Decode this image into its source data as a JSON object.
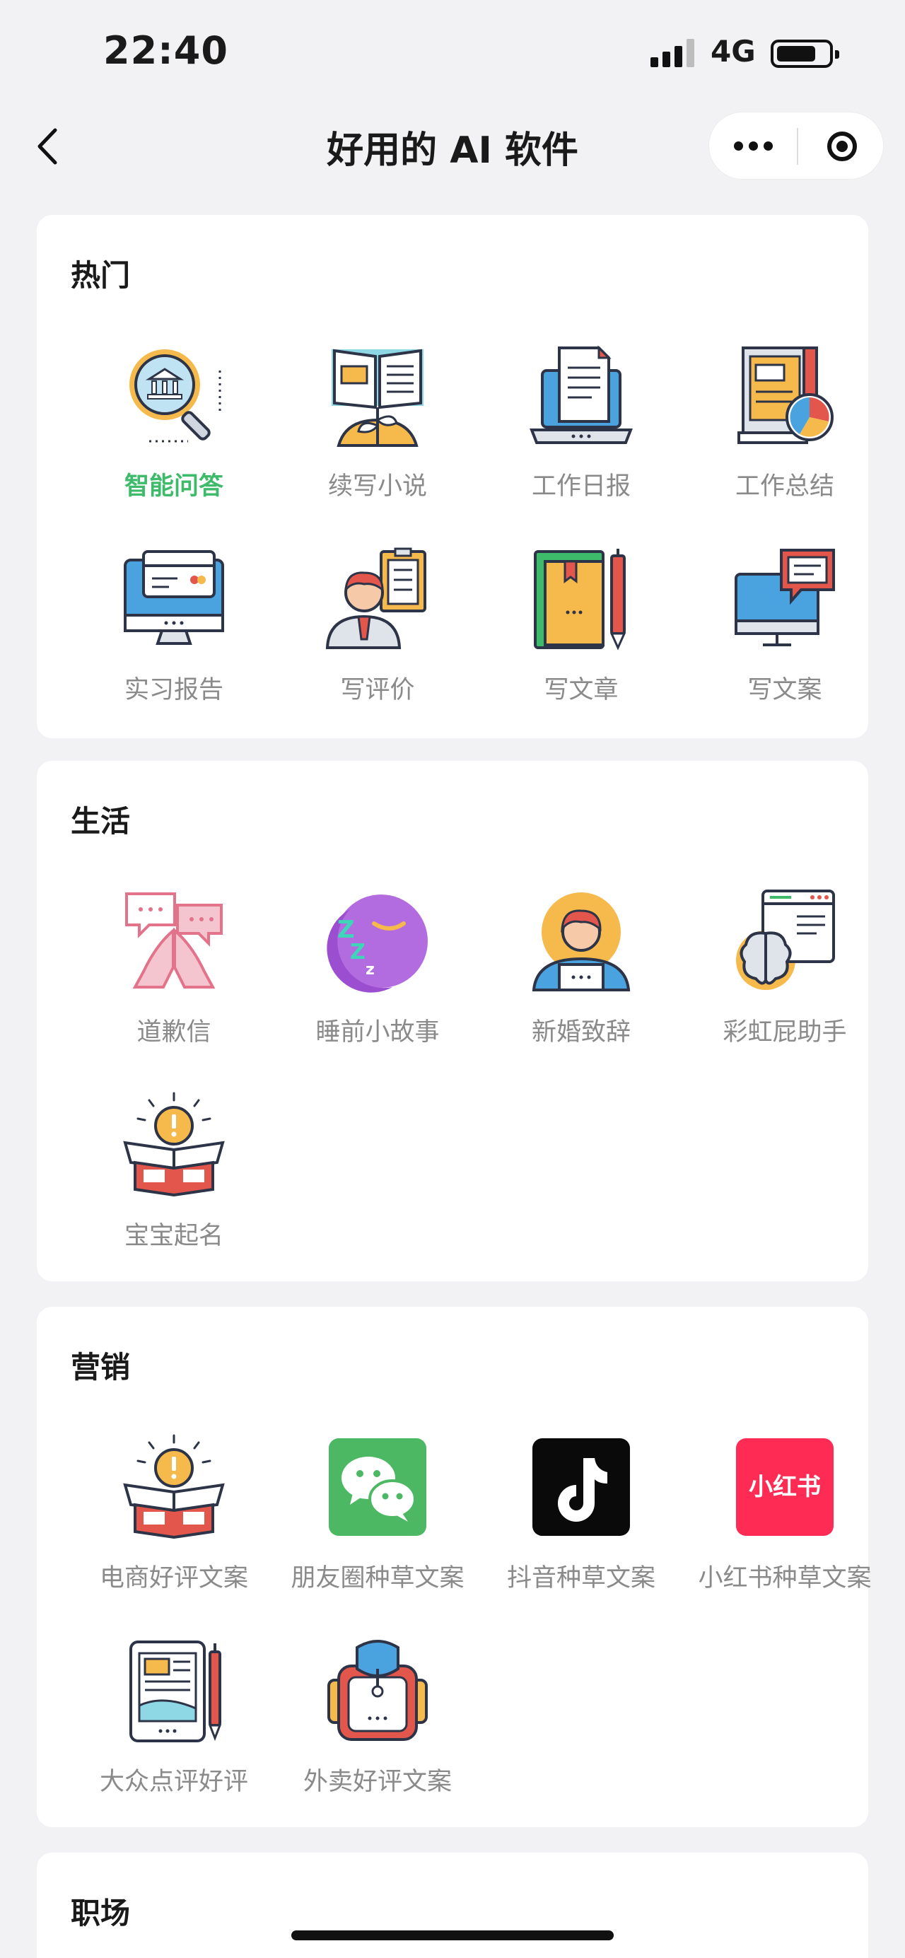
{
  "status_bar": {
    "time": "22:40",
    "network": "4G"
  },
  "nav": {
    "title": "好用的 AI 软件"
  },
  "sections": {
    "hot": {
      "title": "热门",
      "items": [
        {
          "label": "智能问答",
          "icon": "magnifier-bank-icon",
          "active": true
        },
        {
          "label": "续写小说",
          "icon": "open-book-icon"
        },
        {
          "label": "工作日报",
          "icon": "laptop-document-icon"
        },
        {
          "label": "工作总结",
          "icon": "report-chart-icon"
        },
        {
          "label": "实习报告",
          "icon": "monitor-card-icon"
        },
        {
          "label": "写评价",
          "icon": "person-clipboard-icon"
        },
        {
          "label": "写文章",
          "icon": "book-pen-icon"
        },
        {
          "label": "写文案",
          "icon": "monitor-chat-icon"
        }
      ]
    },
    "life": {
      "title": "生活",
      "items": [
        {
          "label": "道歉信",
          "icon": "pray-hands-icon"
        },
        {
          "label": "睡前小故事",
          "icon": "moon-sleep-icon"
        },
        {
          "label": "新婚致辞",
          "icon": "person-laptop-icon"
        },
        {
          "label": "彩虹屁助手",
          "icon": "brain-browser-icon"
        },
        {
          "label": "宝宝起名",
          "icon": "idea-box-icon"
        }
      ]
    },
    "marketing": {
      "title": "营销",
      "items": [
        {
          "label": "电商好评文案",
          "icon": "idea-box-icon"
        },
        {
          "label": "朋友圈种草文案",
          "icon": "wechat-icon"
        },
        {
          "label": "抖音种草文案",
          "icon": "tiktok-icon"
        },
        {
          "label": "小红书种草文案",
          "icon": "xiaohongshu-icon",
          "brand_text": "小红书"
        },
        {
          "label": "大众点评好评",
          "icon": "tablet-pen-icon"
        },
        {
          "label": "外卖好评文案",
          "icon": "backpack-icon"
        }
      ]
    },
    "workplace": {
      "title": "职场"
    }
  },
  "colors": {
    "active_label": "#3dbb6a",
    "label": "#8a8a8a",
    "wechat_green": "#4cb863",
    "xiaohongshu_red": "#fe2c55",
    "page_bg": "#f2f2f4"
  }
}
